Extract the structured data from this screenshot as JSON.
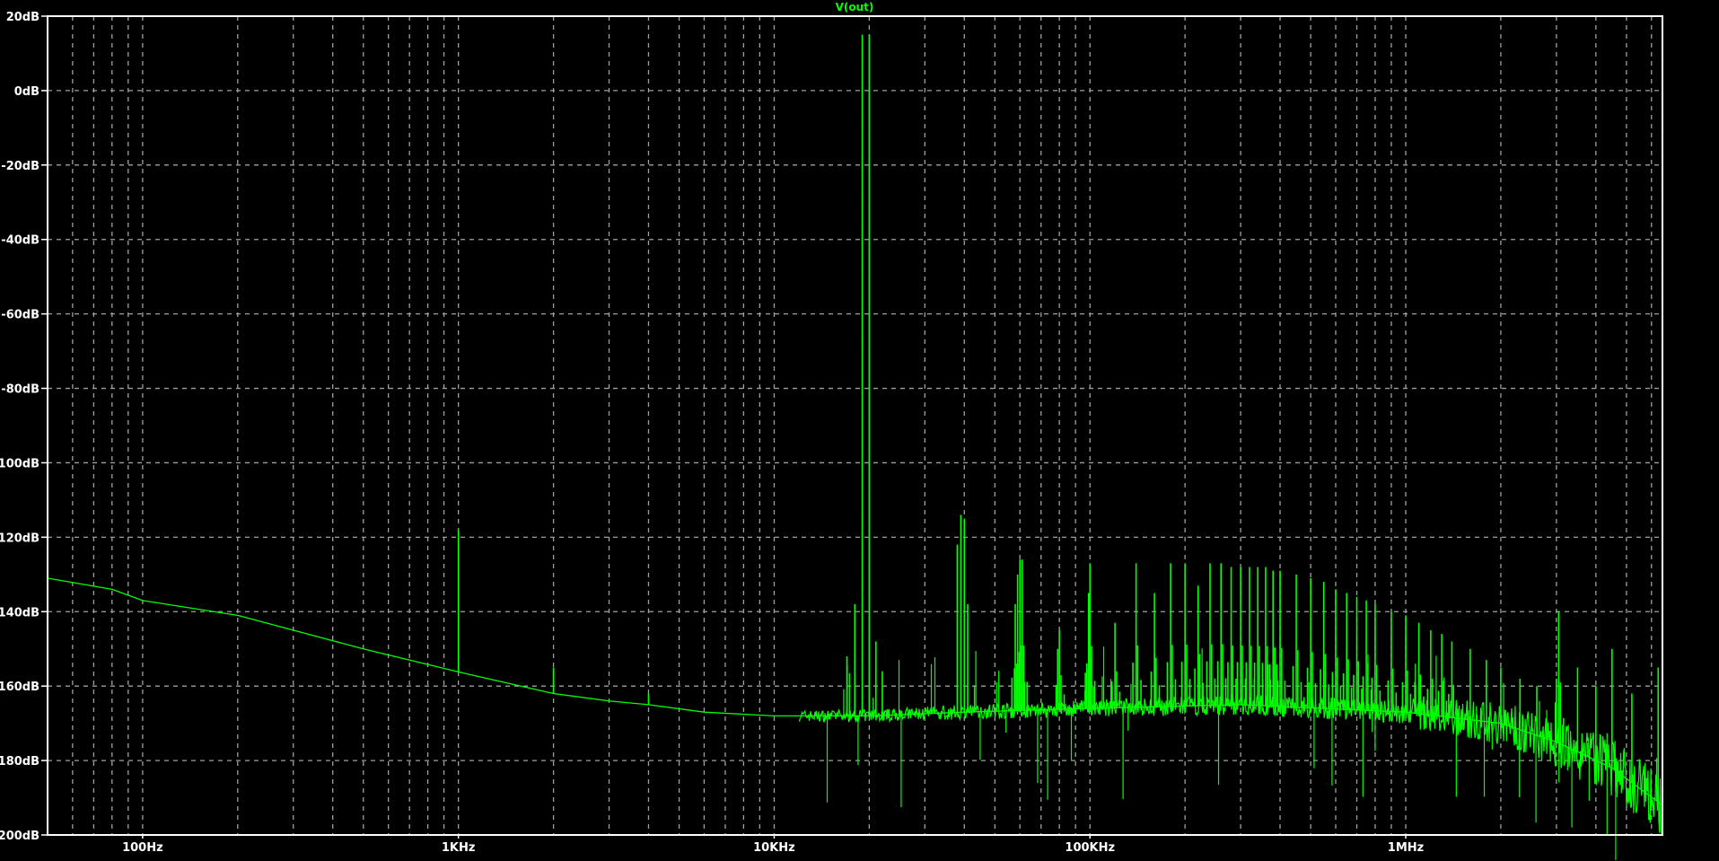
{
  "chart_data": {
    "type": "line",
    "title": "V(out)",
    "xlabel": "",
    "ylabel": "",
    "x_scale": "log",
    "xlim_hz": [
      50,
      6500000
    ],
    "ylim_db": [
      -200,
      20
    ],
    "grid": true,
    "background_color": "#000000",
    "grid_color": "#a0a0a0",
    "axis_color": "#ffffff",
    "trace_color": "#00ff00",
    "y_ticks": [
      {
        "value": 20,
        "label": "20dB"
      },
      {
        "value": 0,
        "label": "0dB"
      },
      {
        "value": -20,
        "label": "-20dB"
      },
      {
        "value": -40,
        "label": "-40dB"
      },
      {
        "value": -60,
        "label": "-60dB"
      },
      {
        "value": -80,
        "label": "-80dB"
      },
      {
        "value": -100,
        "label": "-100dB"
      },
      {
        "value": -120,
        "label": "-120dB"
      },
      {
        "value": -140,
        "label": "-140dB"
      },
      {
        "value": -160,
        "label": "-160dB"
      },
      {
        "value": -180,
        "label": "-180dB"
      },
      {
        "value": -200,
        "label": "-200dB"
      }
    ],
    "x_ticks": [
      {
        "value": 100,
        "label": "100Hz"
      },
      {
        "value": 1000,
        "label": "1KHz"
      },
      {
        "value": 10000,
        "label": "10KHz"
      },
      {
        "value": 100000,
        "label": "100KHz"
      },
      {
        "value": 1000000,
        "label": "1MHz"
      }
    ],
    "series": [
      {
        "noise_floor": [
          [
            50,
            -131
          ],
          [
            80,
            -134
          ],
          [
            100,
            -137
          ],
          [
            200,
            -141
          ],
          [
            500,
            -150
          ],
          [
            980,
            -156
          ],
          [
            1100,
            -157
          ],
          [
            2000,
            -162
          ],
          [
            3000,
            -164
          ],
          [
            4000,
            -165
          ],
          [
            6000,
            -167
          ],
          [
            10000,
            -168
          ],
          [
            15000,
            -168
          ],
          [
            20000,
            -168
          ],
          [
            40000,
            -167
          ],
          [
            100000,
            -166
          ],
          [
            300000,
            -165
          ],
          [
            1000000,
            -167
          ],
          [
            2000000,
            -170
          ],
          [
            3000000,
            -175
          ],
          [
            4500000,
            -182
          ],
          [
            6500000,
            -192
          ]
        ],
        "peaks": [
          [
            1000,
            -118
          ],
          [
            2000,
            -155
          ],
          [
            4000,
            -162
          ],
          [
            17000,
            -152
          ],
          [
            18000,
            -138
          ],
          [
            19000,
            15
          ],
          [
            20000,
            15
          ],
          [
            21000,
            -148
          ],
          [
            22000,
            -156
          ],
          [
            38000,
            -122
          ],
          [
            39000,
            -114
          ],
          [
            40000,
            -115
          ],
          [
            41000,
            -138
          ],
          [
            58000,
            -138
          ],
          [
            59000,
            -130
          ],
          [
            60000,
            -126
          ],
          [
            61000,
            -126
          ],
          [
            79000,
            -150
          ],
          [
            80000,
            -145
          ],
          [
            99000,
            -135
          ],
          [
            100000,
            -127
          ],
          [
            120000,
            -143
          ],
          [
            140000,
            -127
          ],
          [
            160000,
            -135
          ],
          [
            180000,
            -127
          ],
          [
            200000,
            -127
          ],
          [
            220000,
            -133
          ],
          [
            240000,
            -127
          ],
          [
            260000,
            -127
          ],
          [
            280000,
            -128
          ],
          [
            300000,
            -128
          ],
          [
            320000,
            -128
          ],
          [
            340000,
            -128
          ],
          [
            360000,
            -128
          ],
          [
            380000,
            -129
          ],
          [
            400000,
            -129
          ],
          [
            450000,
            -130
          ],
          [
            500000,
            -131
          ],
          [
            550000,
            -132
          ],
          [
            600000,
            -134
          ],
          [
            650000,
            -135
          ],
          [
            700000,
            -136
          ],
          [
            750000,
            -137
          ],
          [
            800000,
            -138
          ],
          [
            900000,
            -140
          ],
          [
            1000000,
            -141
          ],
          [
            1100000,
            -143
          ],
          [
            1200000,
            -145
          ],
          [
            1300000,
            -146
          ],
          [
            1400000,
            -148
          ],
          [
            1600000,
            -150
          ],
          [
            1800000,
            -153
          ],
          [
            2000000,
            -155
          ],
          [
            2300000,
            -158
          ],
          [
            2600000,
            -160
          ],
          [
            3000000,
            -158
          ],
          [
            3050000,
            -140
          ],
          [
            3500000,
            -155
          ],
          [
            4000000,
            -160
          ],
          [
            4500000,
            -150
          ],
          [
            5200000,
            -162
          ],
          [
            6300000,
            -155
          ]
        ]
      }
    ]
  }
}
